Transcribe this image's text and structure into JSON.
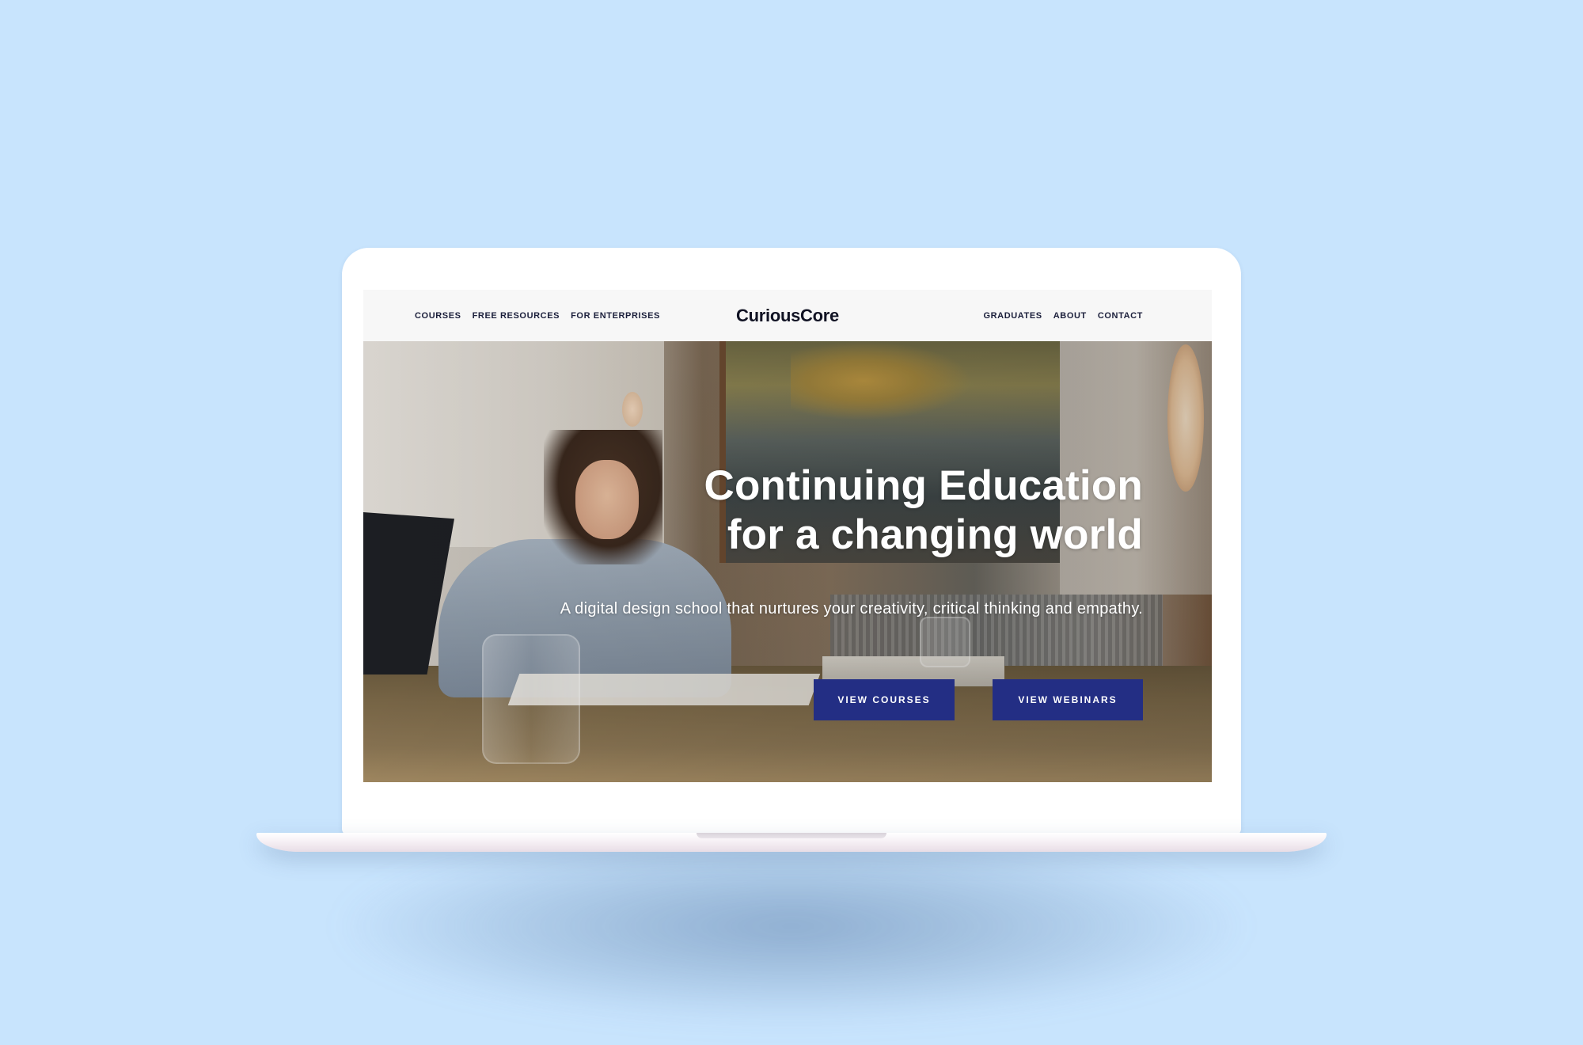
{
  "brand": {
    "logo": "CuriousCore"
  },
  "nav": {
    "left_links": [
      "COURSES",
      "FREE RESOURCES",
      "FOR ENTERPRISES"
    ],
    "right_links": [
      "GRADUATES",
      "ABOUT",
      "CONTACT"
    ]
  },
  "hero": {
    "title_line1": "Continuing Education",
    "title_line2": "for a changing world",
    "subtitle": "A digital design school that nurtures your creativity, critical thinking and empathy.",
    "primary_button": "VIEW COURSES",
    "secondary_button": "VIEW WEBINARS"
  },
  "colors": {
    "background": "#c8e4fd",
    "button": "#232e84",
    "nav_text": "#1b1f3b"
  }
}
